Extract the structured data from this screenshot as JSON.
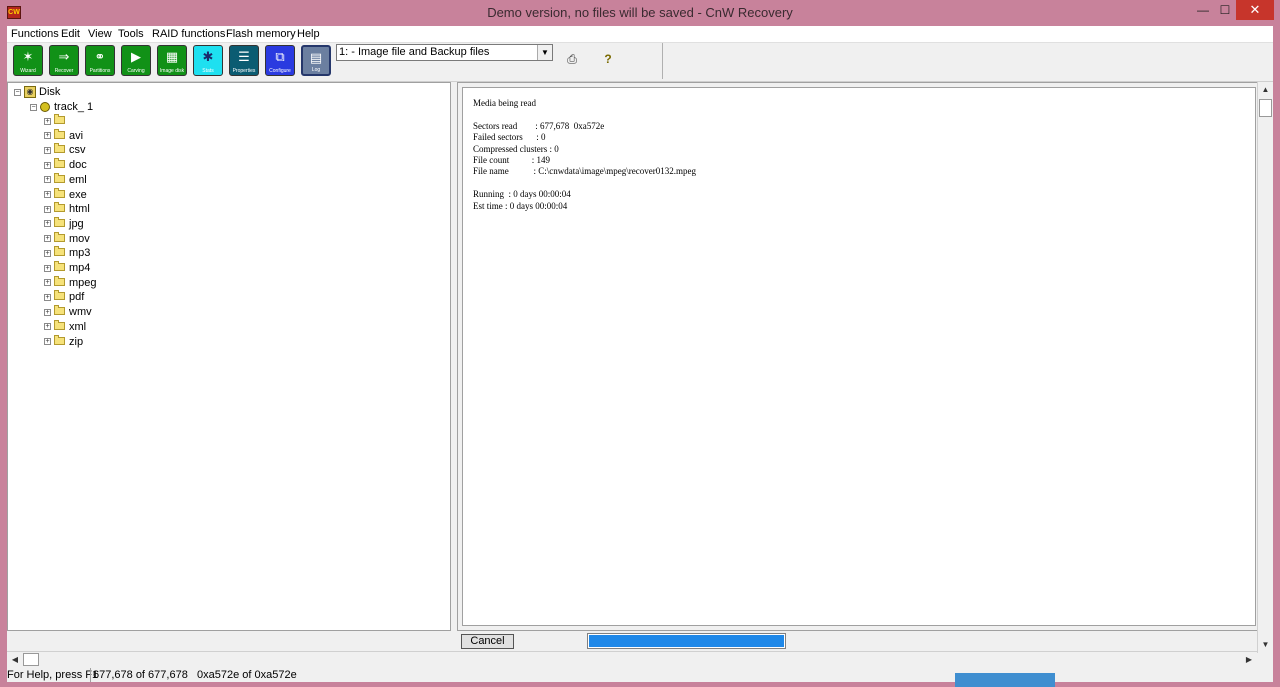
{
  "window": {
    "title": "Demo version, no files will be saved - CnW Recovery",
    "app_icon_text": "CW",
    "min_glyph": "—",
    "max_glyph": "☐",
    "close_glyph": "✕"
  },
  "menu": [
    "Functions",
    "Edit",
    "View",
    "Tools",
    "RAID functions",
    "Flash memory",
    "Help"
  ],
  "toolbar": {
    "buttons": [
      {
        "label": "Wizard",
        "icon": "wand-icon",
        "glyph": "✶",
        "color": "#119117"
      },
      {
        "label": "Recover",
        "icon": "recover-arrow-icon",
        "glyph": "⇒",
        "color": "#119117"
      },
      {
        "label": "Partitions",
        "icon": "partitions-rings-icon",
        "glyph": "⚭",
        "color": "#119117"
      },
      {
        "label": "Carving",
        "icon": "carving-play-icon",
        "glyph": "▶",
        "color": "#119117"
      },
      {
        "label": "Image disk",
        "icon": "image-disk-binary-icon",
        "glyph": "▦",
        "color": "#119117"
      },
      {
        "label": "Stats",
        "icon": "stats-fan-icon",
        "glyph": "✱",
        "color": "#1ee0f0"
      },
      {
        "label": "Properties",
        "icon": "properties-list-icon",
        "glyph": "☰",
        "color": "#0b5c72"
      },
      {
        "label": "Configure",
        "icon": "configure-windows-icon",
        "glyph": "⧉",
        "color": "#2a3ae0"
      },
      {
        "label": "Log",
        "icon": "log-page-icon",
        "glyph": "▤",
        "color": "#6b7fa0"
      }
    ],
    "media_select": {
      "selected": "1: - Image file and Backup files"
    },
    "print_glyph": "⎙",
    "help_glyph": "?"
  },
  "tree": {
    "root": {
      "label": "Disk",
      "expander": "⊟"
    },
    "track": {
      "label": "track_ 1",
      "expander": "⊟"
    },
    "folders": [
      "",
      "avi",
      "csv",
      "doc",
      "eml",
      "exe",
      "html",
      "jpg",
      "mov",
      "mp3",
      "mp4",
      "mpeg",
      "pdf",
      "wmv",
      "xml",
      "zip"
    ],
    "folder_expander": "+"
  },
  "log": {
    "heading": "Media being read",
    "stats": [
      {
        "label": "Sectors read       ",
        "value": "677,678  0xa572e"
      },
      {
        "label": "Failed sectors     ",
        "value": "0"
      },
      {
        "label": "Compressed clusters",
        "value": "0"
      },
      {
        "label": "File count         ",
        "value": "149"
      },
      {
        "label": "File name          ",
        "value": "C:\\cnwdata\\image\\mpeg\\recover0132.mpeg"
      }
    ],
    "running": "Running  : 0 days 00:00:04",
    "est_time": "Est time : 0 days 00:00:04"
  },
  "controls": {
    "cancel_label": "Cancel",
    "progress_fraction": 1.0
  },
  "scroll": {
    "up": "▲",
    "down": "▼",
    "left": "◀",
    "right": "▶"
  },
  "status": {
    "help": "For Help, press F1",
    "count": "677,678 of 677,678",
    "hex": "0xa572e of 0xa572e"
  }
}
